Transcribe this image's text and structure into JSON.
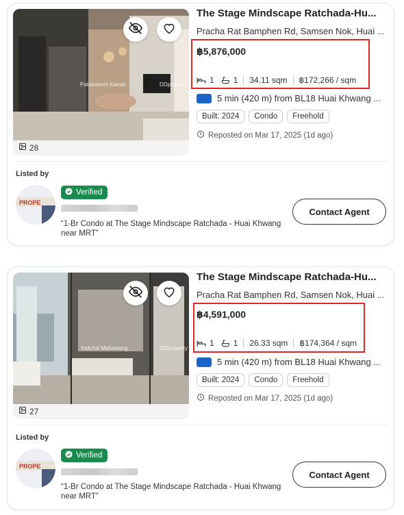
{
  "listings": [
    {
      "title": "The Stage Mindscape Ratchada-Hu...",
      "address": "Pracha Rat Bamphen Rd, Samsen Nok, Huai ...",
      "price": "฿5,876,000",
      "beds": "1",
      "baths": "1",
      "area": "34.11 sqm",
      "price_per_sqm": "฿172,266 / sqm",
      "transit": "5 min (420 m) from BL18 Huai Khwang ...",
      "tags": [
        "Built: 2024",
        "Condo",
        "Freehold"
      ],
      "reposted": "Reposted on Mar 17, 2025 (1d ago)",
      "photo_count": "28",
      "watermark_left": "Pattarasorn Kanan",
      "watermark_right": "DDproperty",
      "listed_by_label": "Listed by",
      "verified_label": "Verified",
      "description": "“1-Br Condo at The Stage Mindscape Ratchada - Huai Khwang near MRT”",
      "contact_label": "Contact Agent"
    },
    {
      "title": "The Stage Mindscape Ratchada-Hu...",
      "address": "Pracha Rat Bamphen Rd, Samsen Nok, Huai ...",
      "price": "฿4,591,000",
      "beds": "1",
      "baths": "1",
      "area": "26.33 sqm",
      "price_per_sqm": "฿174,364 / sqm",
      "transit": "5 min (420 m) from BL18 Huai Khwang ...",
      "tags": [
        "Built: 2024",
        "Condo",
        "Freehold"
      ],
      "reposted": "Reposted on Mar 17, 2025 (1d ago)",
      "photo_count": "27",
      "watermark_left": "Yodchai Mahawong",
      "watermark_right": "DDproperty",
      "listed_by_label": "Listed by",
      "verified_label": "Verified",
      "description": "“1-Br Condo at The Stage Mindscape Ratchada - Huai Khwang near MRT”",
      "contact_label": "Contact Agent"
    }
  ],
  "colors": {
    "highlight_box": "#e52222",
    "verified_bg": "#1a8a4e",
    "transit_line": "#1c64c8"
  },
  "icons": [
    "hide-eye-icon",
    "heart-icon",
    "gallery-icon",
    "bed-icon",
    "bath-icon",
    "clock-icon",
    "check-badge-icon"
  ]
}
